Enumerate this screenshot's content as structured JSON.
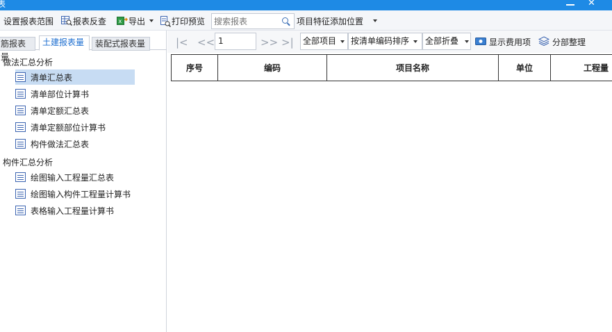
{
  "window": {
    "title": "表"
  },
  "toolbar": {
    "settings_label": "设置报表范围",
    "reverse_label": "报表反查",
    "export_label": "导出",
    "preview_label": "打印预览",
    "search_placeholder": "搜索报表",
    "feature_position_label": "项目特征添加位置"
  },
  "left_panel": {
    "tabs": [
      "筋报表量",
      "土建报表量",
      "装配式报表量"
    ],
    "active_tab": "土建报表量",
    "groups": [
      {
        "label": "做法汇总分析",
        "items": [
          "清单汇总表",
          "清单部位计算书",
          "清单定额汇总表",
          "清单定额部位计算书",
          "构件做法汇总表"
        ]
      },
      {
        "label": "构件汇总分析",
        "items": [
          "绘图输入工程量汇总表",
          "绘图输入构件工程量计算书",
          "表格输入工程量计算书"
        ]
      }
    ],
    "selected_item": "清单汇总表"
  },
  "pager": {
    "first": "|<",
    "prev": "<<",
    "page_value": "1",
    "next": ">>",
    "last": ">|"
  },
  "filters": {
    "project_scope": "全部项目",
    "sort_mode": "按清单编码排序",
    "fold_mode": "全部折叠",
    "show_fee_label": "显示费用项",
    "organize_label": "分部整理"
  },
  "table": {
    "columns": [
      "序号",
      "编码",
      "项目名称",
      "单位",
      "工程量"
    ]
  },
  "colors": {
    "titlebar": "#1e8ae5",
    "selected_row": "#c7dcf3",
    "active_tab_text": "#1e6fd0"
  }
}
